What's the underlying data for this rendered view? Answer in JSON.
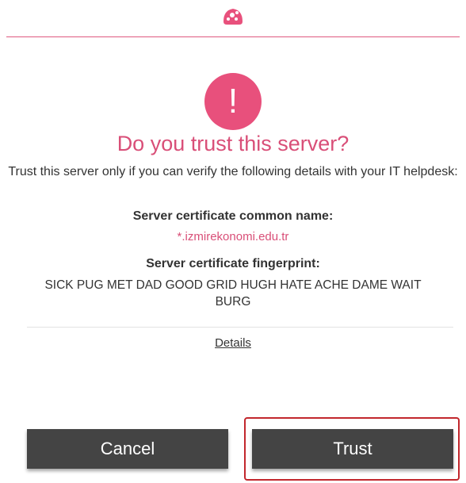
{
  "header": {
    "logo_icon": "nextcloud-bubble-logo",
    "accent_color": "#e0597f"
  },
  "alert": {
    "icon": "exclamation-icon",
    "glyph": "!",
    "color": "#e8507c"
  },
  "dialog": {
    "title": "Do you trust this server?",
    "intro": "Trust this server only if you can verify the following details with your IT helpdesk:",
    "common_name_label": "Server certificate common name:",
    "common_name_value": "*.izmirekonomi.edu.tr",
    "fingerprint_label": "Server certificate fingerprint:",
    "fingerprint_value": "SICK PUG MET DAD GOOD GRID HUGH HATE ACHE DAME WAIT BURG",
    "details_link": "Details"
  },
  "buttons": {
    "cancel_label": "Cancel",
    "trust_label": "Trust",
    "button_color": "#444444",
    "highlight_color": "#c2272d"
  }
}
